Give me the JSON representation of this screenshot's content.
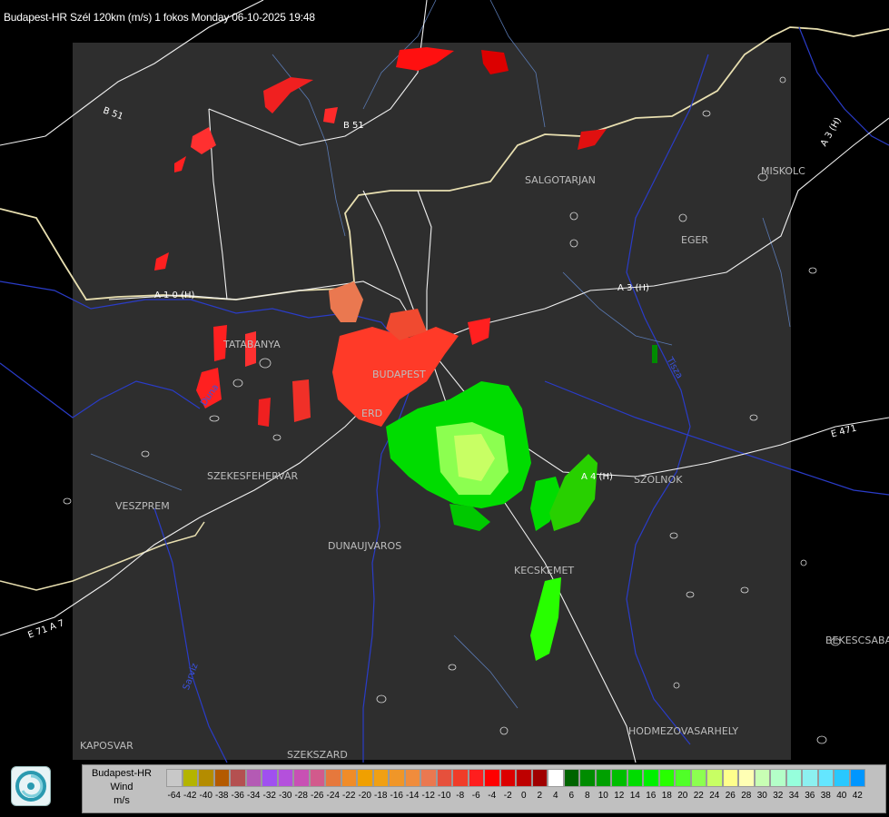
{
  "title": "Budapest-HR Szél 120km (m/s) 1 fokos Monday 06-10-2025 19:48",
  "cities": [
    {
      "name": "SALGOTARJAN"
    },
    {
      "name": "MISKOLC"
    },
    {
      "name": "EGER"
    },
    {
      "name": "TATABANYA"
    },
    {
      "name": "BUDAPEST"
    },
    {
      "name": "ERD"
    },
    {
      "name": "SZEKESFEHERVAR"
    },
    {
      "name": "VESZPREM"
    },
    {
      "name": "DUNAUJVAROS"
    },
    {
      "name": "SZOLNOK"
    },
    {
      "name": "KECSKEMET"
    },
    {
      "name": "BEKESCSABA"
    },
    {
      "name": "HODMEZOVASARHELY"
    },
    {
      "name": "KAPOSVAR"
    },
    {
      "name": "SZEKSZARD"
    }
  ],
  "roads": [
    {
      "name": "B 51"
    },
    {
      "name": "B 51"
    },
    {
      "name": "A 3 (H)"
    },
    {
      "name": "A 3 (H)"
    },
    {
      "name": "A 1 0 (H)"
    },
    {
      "name": "A 4 (H)"
    },
    {
      "name": "E 471"
    },
    {
      "name": "E 71 A 7"
    },
    {
      "name": "Tisza"
    },
    {
      "name": "Duna"
    },
    {
      "name": "Sarviz"
    }
  ],
  "legend": {
    "line1": "Budapest-HR",
    "line2": "Wind",
    "line3": "m/s",
    "colors": [
      "#c8c8c8",
      "#b4b400",
      "#b48c00",
      "#b45a00",
      "#b45050",
      "#b45ab4",
      "#a050f0",
      "#b450dc",
      "#c850b4",
      "#d25a8c",
      "#e6783c",
      "#f08c28",
      "#f0a000",
      "#f0a014",
      "#f09628",
      "#f08c3c",
      "#ea7850",
      "#e6503c",
      "#f03c28",
      "#ff1e1e",
      "#ff0000",
      "#dc0000",
      "#be0000",
      "#a00000",
      "#ffffff",
      "#006400",
      "#008c00",
      "#00a000",
      "#00be00",
      "#00dc00",
      "#00f000",
      "#28ff00",
      "#50ff28",
      "#8cff50",
      "#c8ff64",
      "#ffff8c",
      "#ffffb4",
      "#c8ffb4",
      "#b4ffc8",
      "#96ffdc",
      "#8cf0f0",
      "#64e6ff",
      "#28c8ff",
      "#0096ff",
      "#0064ff",
      "#0032ff",
      "#0000ff"
    ],
    "ticks": [
      "-64",
      "-42",
      "-40",
      "-38",
      "-36",
      "-34",
      "-32",
      "-30",
      "-28",
      "-26",
      "-24",
      "-22",
      "-20",
      "-18",
      "-16",
      "-14",
      "-12",
      "-10",
      "-8",
      "-6",
      "-4",
      "-2",
      "0",
      "2",
      "4",
      "6",
      "8",
      "10",
      "12",
      "14",
      "16",
      "18",
      "20",
      "22",
      "24",
      "26",
      "28",
      "30",
      "32",
      "34",
      "36",
      "38",
      "40",
      "42"
    ]
  }
}
